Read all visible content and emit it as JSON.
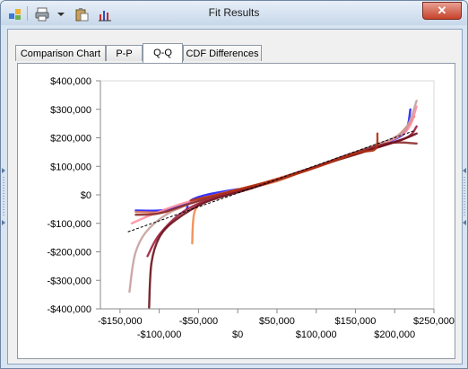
{
  "window": {
    "title": "Fit Results",
    "close_label": "✕",
    "toolbar": [
      {
        "name": "app-icon",
        "kind": "app"
      },
      {
        "name": "print-icon",
        "kind": "print"
      },
      {
        "name": "dropdown-arrow-icon",
        "kind": "dropdown"
      },
      {
        "name": "clipboard-icon",
        "kind": "clipboard"
      },
      {
        "name": "chart-icon",
        "kind": "chart"
      }
    ]
  },
  "tabs": [
    {
      "label": "Comparison Chart",
      "active": false
    },
    {
      "label": "P-P",
      "active": false
    },
    {
      "label": "Q-Q",
      "active": true
    },
    {
      "label": "CDF Differences",
      "active": false
    }
  ],
  "chart_data": {
    "type": "line",
    "title": "",
    "xlabel": "",
    "ylabel": "",
    "xlim": [
      -175000,
      250000
    ],
    "ylim": [
      -400000,
      400000
    ],
    "x_ticks": [
      -150000,
      -100000,
      -50000,
      0,
      50000,
      100000,
      150000,
      200000,
      250000
    ],
    "x_tick_labels_top": [
      "-$150,000",
      "-$50,000",
      "$50,000",
      "$150,000",
      "$250,000"
    ],
    "x_tick_labels_bottom": [
      "-$100,000",
      "$0",
      "$100,000",
      "$200,000"
    ],
    "y_ticks": [
      400000,
      300000,
      200000,
      100000,
      0,
      -100000,
      -200000,
      -300000,
      -400000
    ],
    "y_tick_labels": [
      "$400,000",
      "$300,000",
      "$200,000",
      "$100,000",
      "$0",
      "-$100,000",
      "-$200,000",
      "-$300,000",
      "-$400,000"
    ],
    "grid": false,
    "reference_line": {
      "x": [
        -140000,
        225000
      ],
      "y": [
        -130000,
        225000
      ]
    },
    "series": [
      {
        "color": "#1f1fff",
        "points": [
          [
            -130000,
            -55000
          ],
          [
            -100000,
            -55000
          ],
          [
            -80000,
            -45000
          ],
          [
            -40000,
            -10000
          ],
          [
            0,
            15000
          ],
          [
            50000,
            50000
          ],
          [
            100000,
            100000
          ],
          [
            150000,
            150000
          ],
          [
            200000,
            195000
          ],
          [
            215000,
            230000
          ],
          [
            220000,
            300000
          ]
        ]
      },
      {
        "color": "#1f1fff",
        "points": [
          [
            -65000,
            -50000
          ],
          [
            -60000,
            -20000
          ],
          [
            -40000,
            0
          ],
          [
            0,
            20000
          ]
        ]
      },
      {
        "color": "#f08a4b",
        "points": [
          [
            -58000,
            -170000
          ],
          [
            -55000,
            -60000
          ],
          [
            -40000,
            -15000
          ],
          [
            0,
            15000
          ],
          [
            50000,
            48000
          ],
          [
            100000,
            100000
          ],
          [
            150000,
            150000
          ],
          [
            200000,
            200000
          ],
          [
            220000,
            250000
          ]
        ]
      },
      {
        "color": "#e07050",
        "points": [
          [
            -130000,
            -60000
          ],
          [
            -90000,
            -60000
          ],
          [
            -60000,
            -30000
          ],
          [
            -20000,
            5000
          ],
          [
            30000,
            40000
          ],
          [
            100000,
            100000
          ],
          [
            170000,
            165000
          ],
          [
            205000,
            210000
          ],
          [
            225000,
            275000
          ]
        ]
      },
      {
        "color": "#ff8ea0",
        "points": [
          [
            -135000,
            -100000
          ],
          [
            -110000,
            -70000
          ],
          [
            -70000,
            -30000
          ],
          [
            -20000,
            5000
          ],
          [
            40000,
            45000
          ],
          [
            110000,
            110000
          ],
          [
            180000,
            175000
          ],
          [
            215000,
            225000
          ],
          [
            228000,
            310000
          ]
        ]
      },
      {
        "color": "#c8a0a0",
        "points": [
          [
            -138000,
            -340000
          ],
          [
            -130000,
            -200000
          ],
          [
            -110000,
            -110000
          ],
          [
            -70000,
            -40000
          ],
          [
            0,
            15000
          ],
          [
            80000,
            80000
          ],
          [
            160000,
            160000
          ],
          [
            210000,
            220000
          ],
          [
            228000,
            330000
          ]
        ]
      },
      {
        "color": "#8a2b2b",
        "points": [
          [
            -130000,
            -70000
          ],
          [
            -100000,
            -65000
          ],
          [
            -60000,
            -30000
          ],
          [
            -10000,
            10000
          ],
          [
            60000,
            60000
          ],
          [
            130000,
            130000
          ],
          [
            190000,
            180000
          ],
          [
            228000,
            180000
          ]
        ]
      },
      {
        "color": "#a02040",
        "points": [
          [
            -115000,
            -215000
          ],
          [
            -100000,
            -140000
          ],
          [
            -70000,
            -60000
          ],
          [
            -30000,
            -10000
          ],
          [
            30000,
            35000
          ],
          [
            100000,
            100000
          ],
          [
            170000,
            160000
          ],
          [
            215000,
            200000
          ],
          [
            228000,
            240000
          ]
        ]
      },
      {
        "color": "#6b0f1a",
        "points": [
          [
            -113000,
            -395000
          ],
          [
            -110000,
            -240000
          ],
          [
            -100000,
            -150000
          ],
          [
            -80000,
            -90000
          ],
          [
            -40000,
            -25000
          ],
          [
            20000,
            25000
          ],
          [
            90000,
            90000
          ],
          [
            160000,
            150000
          ],
          [
            210000,
            195000
          ],
          [
            228000,
            215000
          ]
        ]
      },
      {
        "color": "#b03010",
        "points": [
          [
            -60000,
            -20000
          ],
          [
            0,
            18000
          ],
          [
            80000,
            78000
          ],
          [
            150000,
            145000
          ],
          [
            175000,
            160000
          ],
          [
            178000,
            215000
          ]
        ]
      }
    ]
  }
}
